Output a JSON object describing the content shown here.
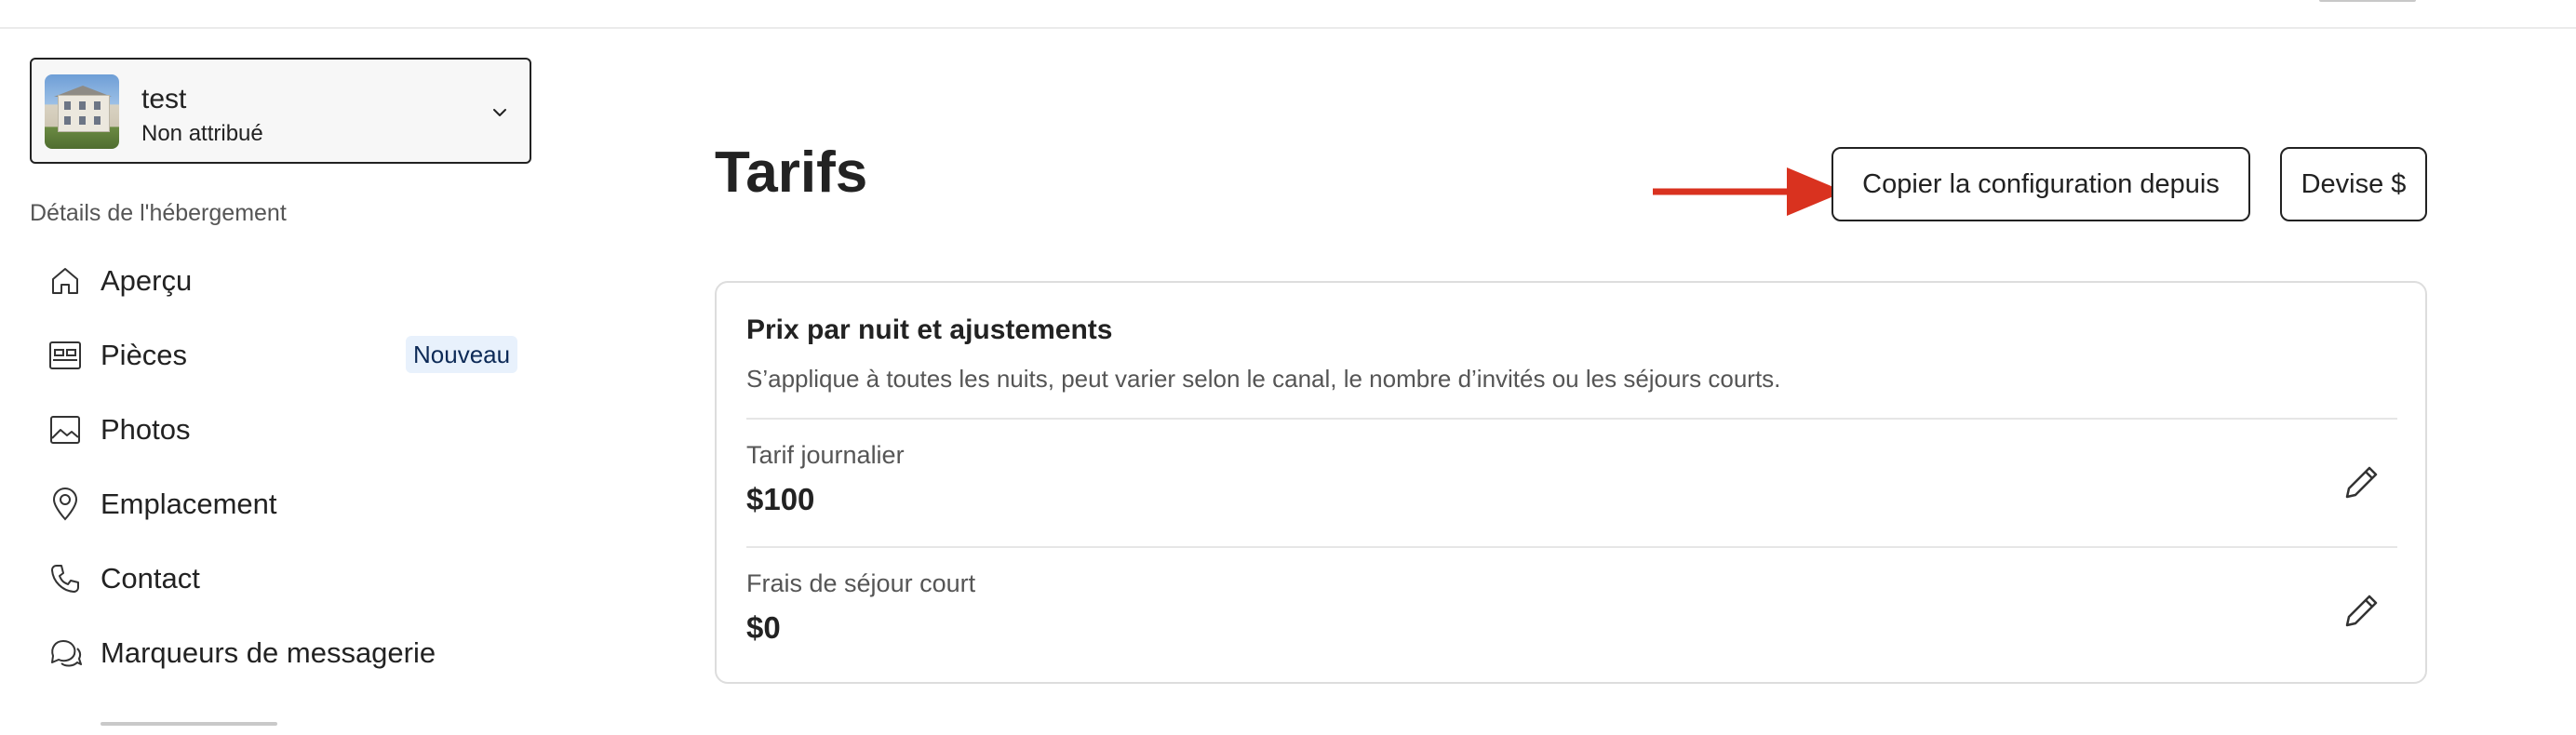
{
  "listing": {
    "name": "test",
    "status": "Non attribué"
  },
  "sidebar": {
    "section_label": "Détails de l'hébergement",
    "items": [
      {
        "label": "Aperçu",
        "icon": "home-icon"
      },
      {
        "label": "Pièces",
        "icon": "bed-icon",
        "badge": "Nouveau"
      },
      {
        "label": "Photos",
        "icon": "image-icon"
      },
      {
        "label": "Emplacement",
        "icon": "location-pin-icon"
      },
      {
        "label": "Contact",
        "icon": "phone-icon"
      },
      {
        "label": "Marqueurs de messagerie",
        "icon": "chat-bubbles-icon"
      }
    ]
  },
  "main": {
    "title": "Tarifs",
    "copy_config_label": "Copier la configuration depuis",
    "currency_label": "Devise $",
    "card": {
      "title": "Prix par nuit et ajustements",
      "description": "S’applique à toutes les nuits, peut varier selon le canal, le nombre d’invités ou les séjours courts.",
      "rows": [
        {
          "label": "Tarif journalier",
          "value": "$100"
        },
        {
          "label": "Frais de séjour court",
          "value": "$0"
        }
      ]
    }
  },
  "colors": {
    "accent_arrow": "#d9321f",
    "badge_bg": "#e8f1fc",
    "text": "#222222",
    "muted": "#555555",
    "border": "#dddddd"
  }
}
